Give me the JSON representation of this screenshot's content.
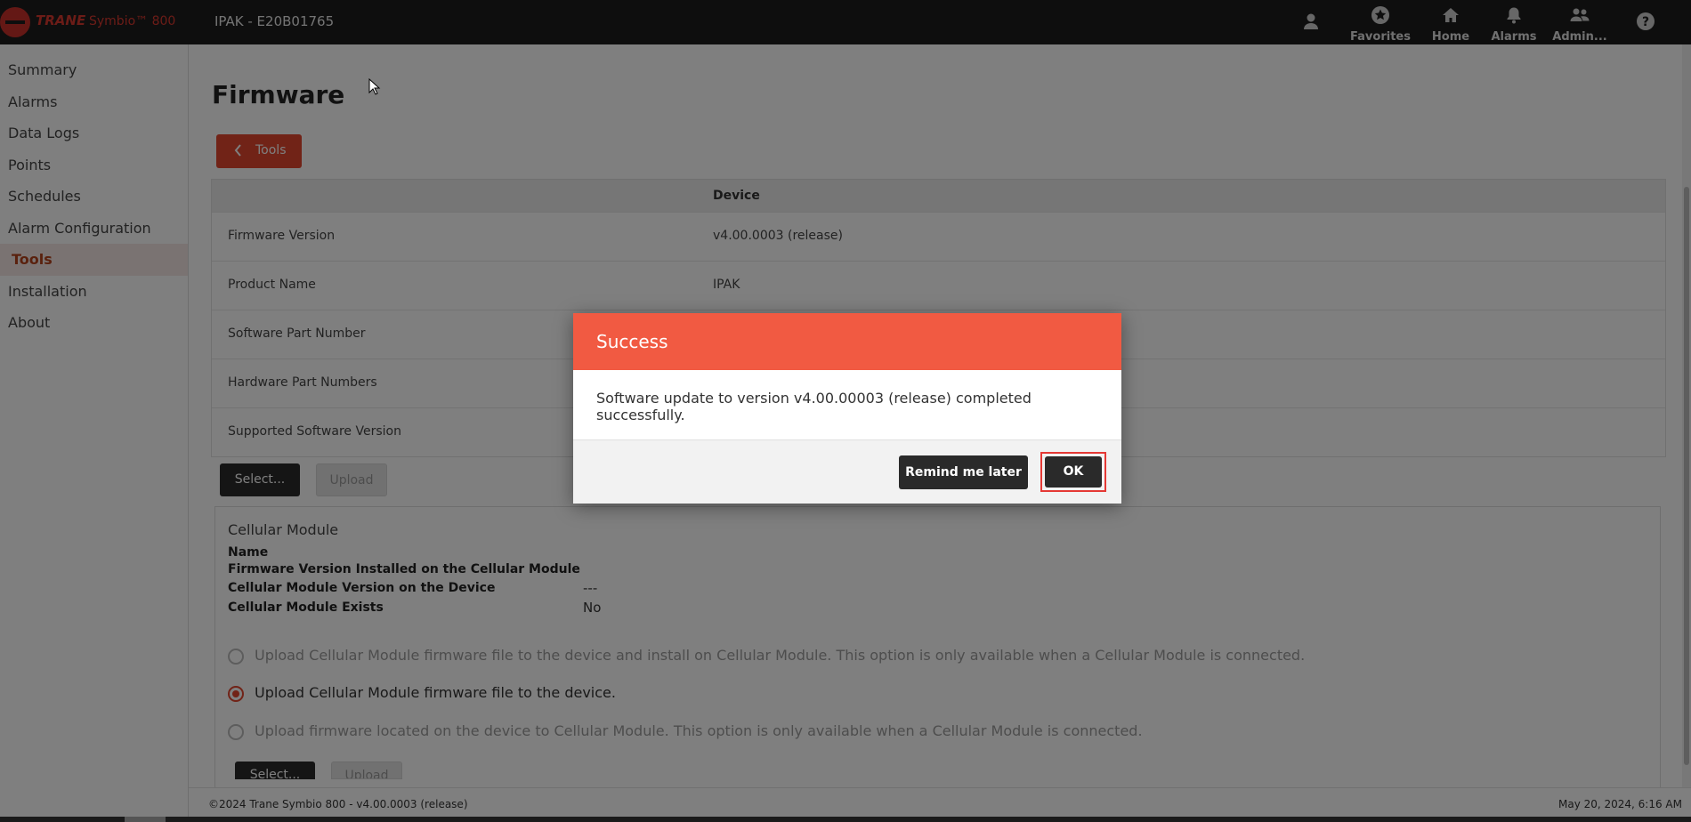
{
  "app": {
    "brand": "TRANE",
    "product": "Symbio™ 800",
    "device_title": "IPAK - E20B01765"
  },
  "top_nav": {
    "favorites": "Favorites",
    "home": "Home",
    "alarms": "Alarms",
    "admin": "Admin..."
  },
  "sidebar": {
    "items": [
      {
        "label": "Summary"
      },
      {
        "label": "Alarms"
      },
      {
        "label": "Data Logs"
      },
      {
        "label": "Points"
      },
      {
        "label": "Schedules"
      },
      {
        "label": "Alarm Configuration"
      },
      {
        "label": "Tools"
      },
      {
        "label": "Installation"
      },
      {
        "label": "About"
      }
    ],
    "active": "Tools"
  },
  "page": {
    "title": "Firmware",
    "back_label": "Tools"
  },
  "info_table": {
    "column_header": "Device",
    "rows": [
      {
        "label": "Firmware Version",
        "value": "v4.00.0003 (release)"
      },
      {
        "label": "Product Name",
        "value": "IPAK"
      },
      {
        "label": "Software Part Number",
        "value": ""
      },
      {
        "label": "Hardware Part Numbers",
        "value": ""
      },
      {
        "label": "Supported Software Version",
        "value": ""
      }
    ]
  },
  "actions": {
    "select_label": "Select...",
    "upload_label": "Upload"
  },
  "cellular": {
    "title": "Cellular Module",
    "fields": [
      {
        "label": "Name",
        "value": ""
      },
      {
        "label": "Firmware Version Installed on the Cellular Module",
        "value": ""
      },
      {
        "label": "Cellular Module Version on the Device",
        "value": "---"
      },
      {
        "label": "Cellular Module Exists",
        "value": "No"
      }
    ],
    "options": [
      {
        "label": "Upload Cellular Module firmware file to the device and install on Cellular Module. This option is only available when a Cellular Module is connected.",
        "checked": false
      },
      {
        "label": "Upload Cellular Module firmware file to the device.",
        "checked": true
      },
      {
        "label": "Upload firmware located on the device to Cellular Module. This option is only available when a Cellular Module is connected.",
        "checked": false
      }
    ],
    "select_label": "Select...",
    "upload_label": "Upload"
  },
  "footer": {
    "copyright": "©2024 Trane Symbio 800 - v4.00.0003 (release)",
    "timestamp": "May 20, 2024, 6:16 AM"
  },
  "modal": {
    "title": "Success",
    "message": "Software update to version v4.00.00003 (release) completed successfully.",
    "remind_label": "Remind me later",
    "ok_label": "OK"
  },
  "colors": {
    "accent": "#e2462f",
    "modal_header": "#f15a42",
    "topbar": "#1c1c1c",
    "button_dark": "#2a2a2a"
  }
}
